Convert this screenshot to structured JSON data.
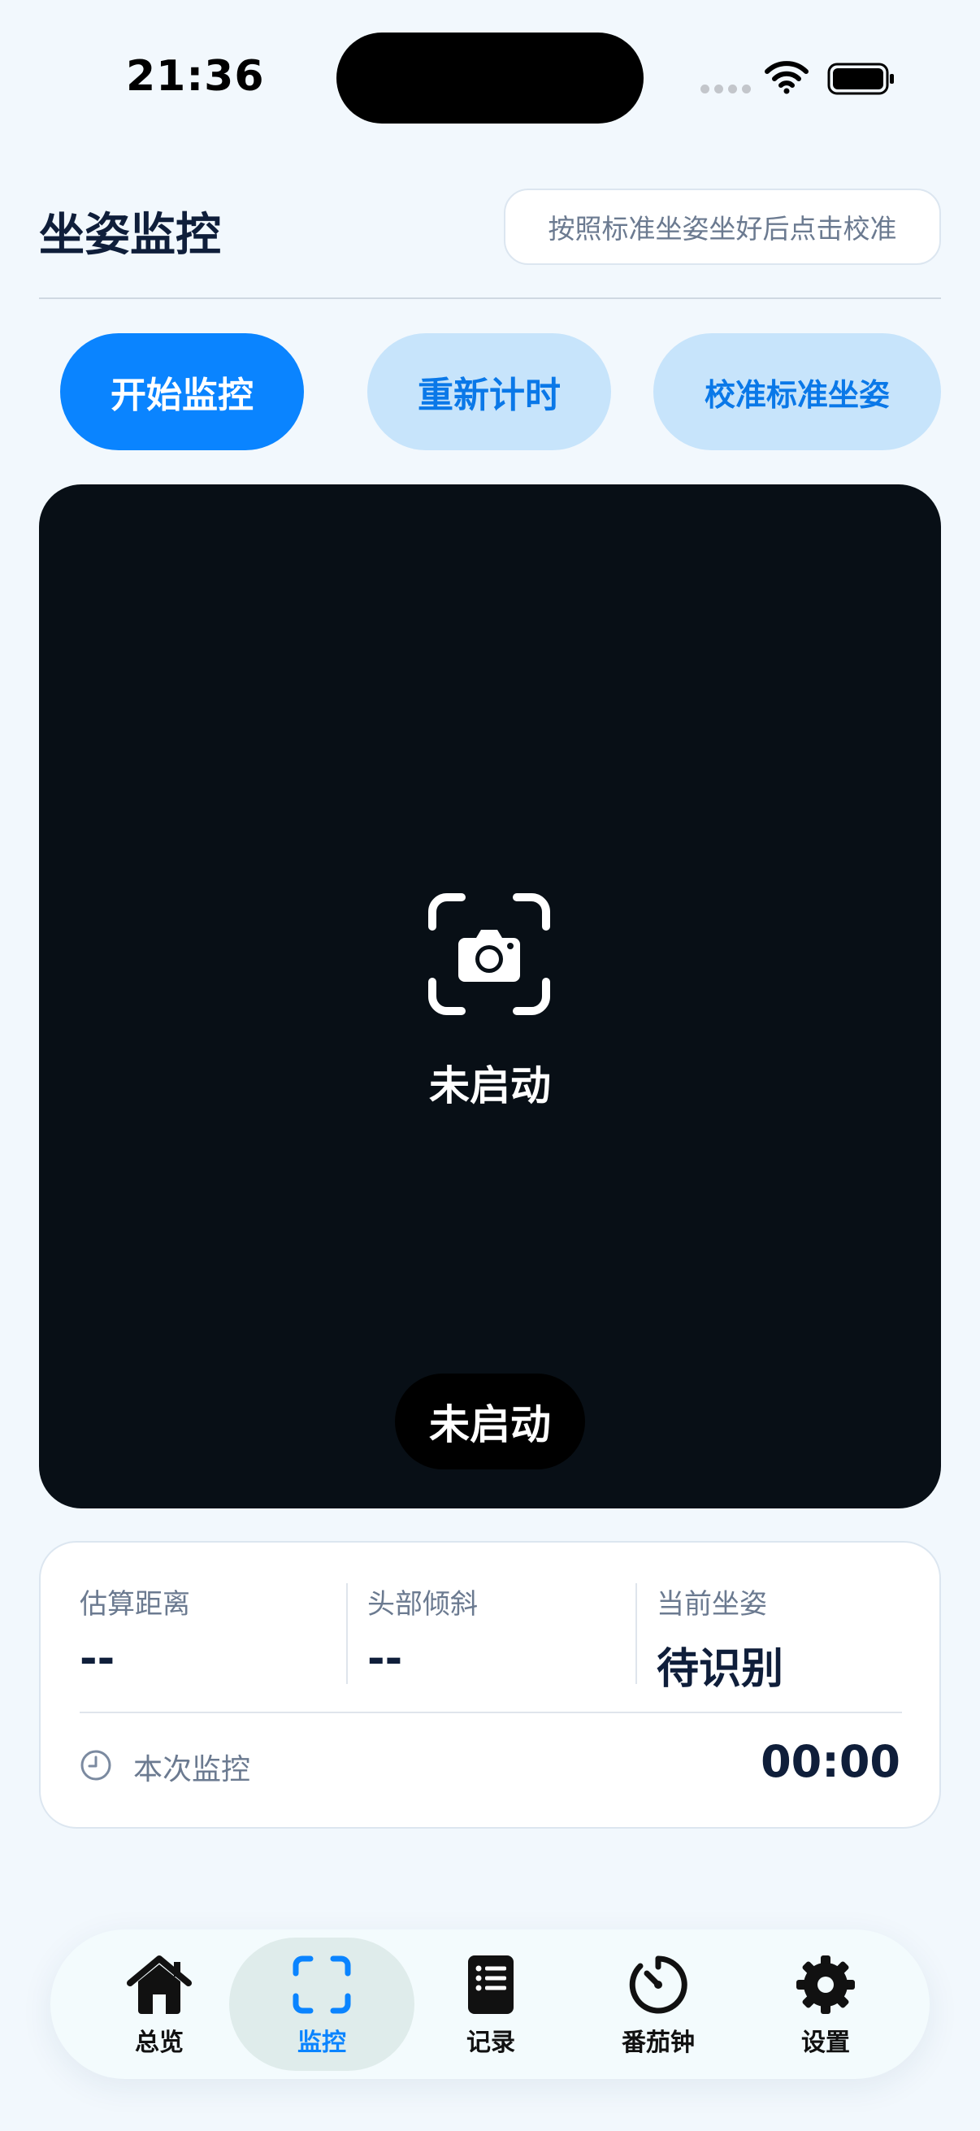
{
  "status_bar": {
    "time": "21:36"
  },
  "header": {
    "title": "坐姿监控",
    "hint": "按照标准坐姿坐好后点击校准"
  },
  "actions": {
    "start": "开始监控",
    "reset": "重新计时",
    "calibrate": "校准标准坐姿"
  },
  "camera": {
    "status": "未启动",
    "badge": "未启动"
  },
  "stats": {
    "distance": {
      "label": "估算距离",
      "value": "--"
    },
    "head_tilt": {
      "label": "头部倾斜",
      "value": "--"
    },
    "posture": {
      "label": "当前坐姿",
      "value": "待识别"
    },
    "session": {
      "label": "本次监控",
      "value": "00:00"
    }
  },
  "tab_bar": {
    "items": [
      {
        "label": "总览",
        "icon": "house-icon"
      },
      {
        "label": "监控",
        "icon": "viewfinder-icon",
        "active": true
      },
      {
        "label": "记录",
        "icon": "list-icon"
      },
      {
        "label": "番茄钟",
        "icon": "timer-icon"
      },
      {
        "label": "设置",
        "icon": "gear-icon"
      }
    ]
  },
  "colors": {
    "accent": "#0a84ff",
    "secondary_button_bg": "#c7e4fb",
    "camera_bg": "#080f16",
    "page_bg": "#f2f8fd"
  }
}
